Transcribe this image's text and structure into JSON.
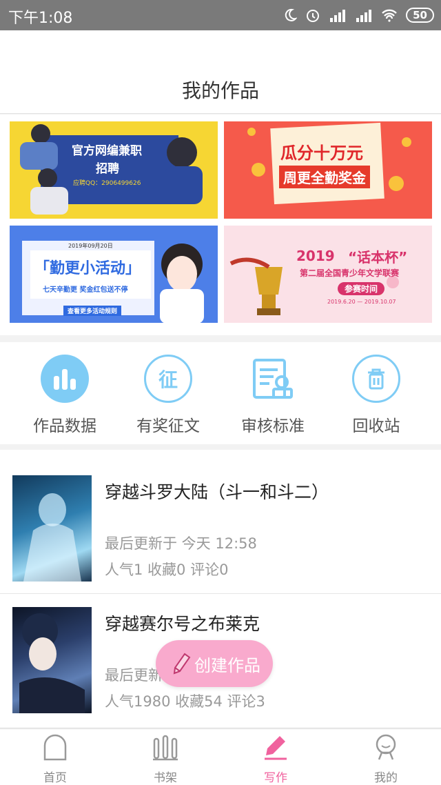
{
  "status": {
    "time": "下午1:08",
    "battery": "50"
  },
  "header": {
    "title": "我的作品"
  },
  "banners": {
    "recruit": {
      "title": "官方网编兼职",
      "subtitle": "招聘",
      "qq": "应聘QQ：2906499626"
    },
    "bonus": {
      "line1": "瓜分十万元",
      "line2": "周更全勤奖金"
    },
    "activity": {
      "date": "2019年09月20日",
      "title": "「勤更小活动」",
      "subtitle": "七天辛勤更 奖金红包送不停",
      "link": "查看更多活动规则"
    },
    "contest": {
      "year": "2019",
      "name": "“话本杯”",
      "subtitle": "第二届全国青少年文学联赛",
      "stamp": "参赛时间",
      "dates": "2019.6.20 — 2019.10.07"
    }
  },
  "quick_actions": [
    {
      "label": "作品数据",
      "icon": "bar-chart-icon"
    },
    {
      "label": "有奖征文",
      "icon": "contest-icon"
    },
    {
      "label": "审核标准",
      "icon": "review-document-icon"
    },
    {
      "label": "回收站",
      "icon": "trash-icon"
    }
  ],
  "works": [
    {
      "title": "穿越斗罗大陆（斗一和斗二）",
      "updated": "最后更新于 今天 12:58",
      "stats": "人气1 收藏0 评论0"
    },
    {
      "title": "穿越赛尔号之布莱克",
      "updated": "最后更新于",
      "stats": "人气1980 收藏54 评论3"
    }
  ],
  "fab": {
    "label": "创建作品"
  },
  "tabs": [
    {
      "label": "首页",
      "icon": "home-icon"
    },
    {
      "label": "书架",
      "icon": "bookshelf-icon"
    },
    {
      "label": "写作",
      "icon": "pen-icon"
    },
    {
      "label": "我的",
      "icon": "profile-icon"
    }
  ],
  "colors": {
    "accent": "#f0629e",
    "icon_blue": "#6fc3f2",
    "fab": "#f9aacd"
  }
}
